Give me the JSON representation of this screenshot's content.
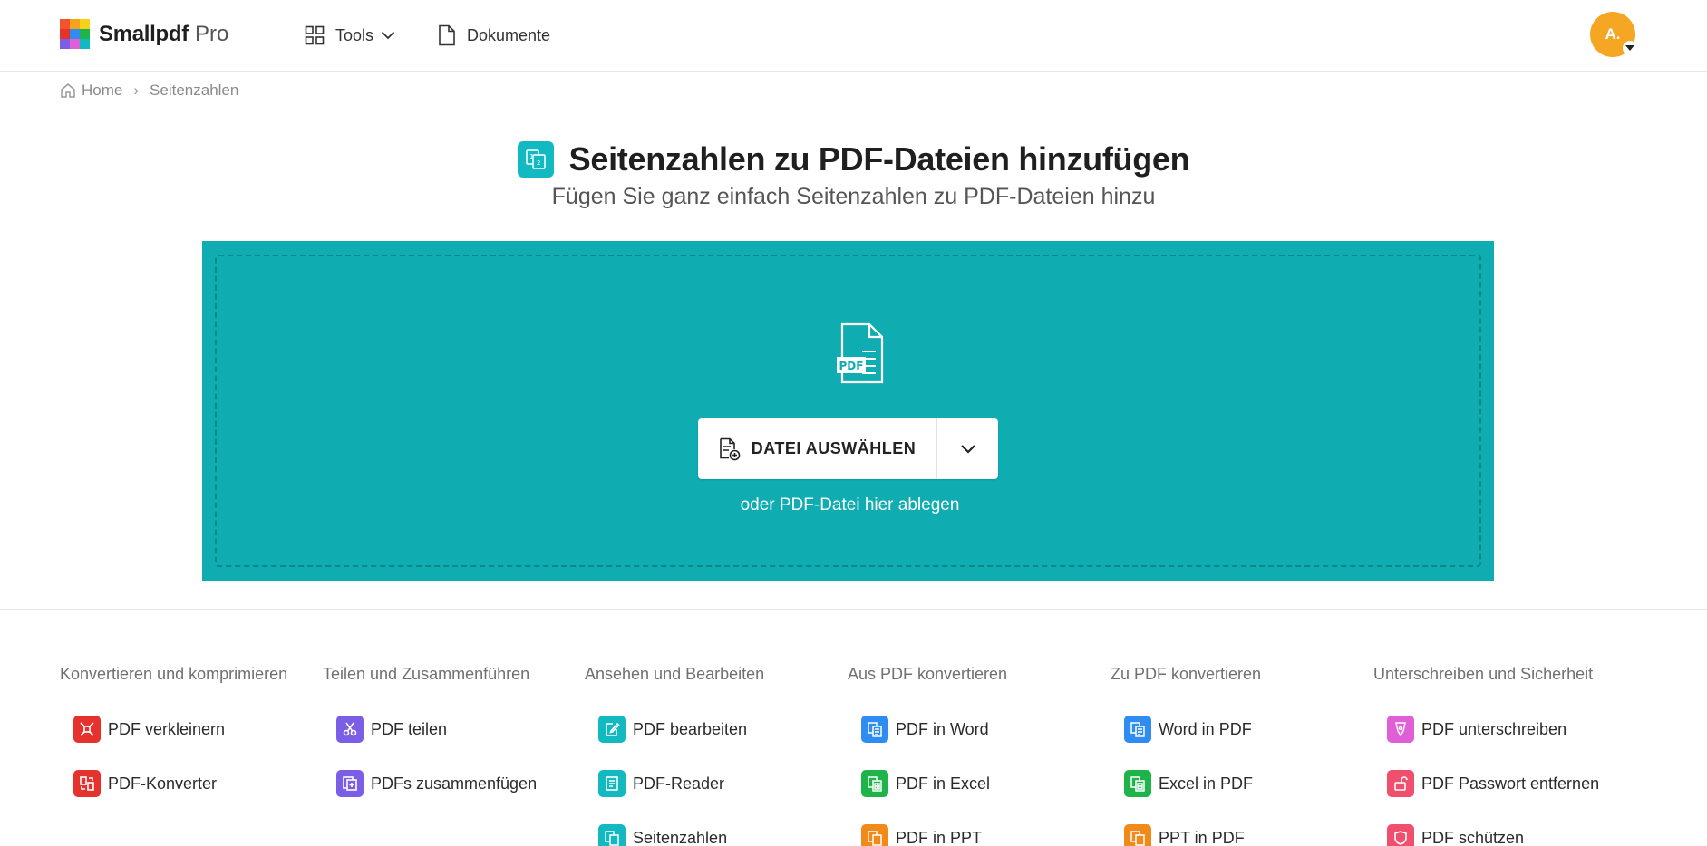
{
  "header": {
    "logo_name": "Smallpdf",
    "logo_suffix": "Pro",
    "nav": {
      "tools_label": "Tools",
      "documents_label": "Dokumente"
    },
    "avatar_initials": "A."
  },
  "breadcrumb": {
    "home": "Home",
    "separator": "›",
    "current": "Seitenzahlen"
  },
  "page": {
    "title": "Seitenzahlen zu PDF-Dateien hinzufügen",
    "subtitle": "Fügen Sie ganz einfach Seitenzahlen zu PDF-Dateien hinzu"
  },
  "upload": {
    "pdf_icon_label": "PDF",
    "choose_button": "DATEI AUSWÄHLEN",
    "drop_hint": "oder PDF-Datei hier ablegen",
    "background_color": "#0fadb1"
  },
  "categories": [
    {
      "title": "Konvertieren und komprimieren",
      "tools": [
        {
          "label": "PDF verkleinern",
          "icon": "compress-icon",
          "color": "#e5322d"
        },
        {
          "label": "PDF-Konverter",
          "icon": "convert-icon",
          "color": "#e5322d"
        }
      ]
    },
    {
      "title": "Teilen und Zusammenführen",
      "tools": [
        {
          "label": "PDF teilen",
          "icon": "scissors-icon",
          "color": "#7c5de6"
        },
        {
          "label": "PDFs zusammenfügen",
          "icon": "merge-icon",
          "color": "#7c5de6"
        }
      ]
    },
    {
      "title": "Ansehen und Bearbeiten",
      "tools": [
        {
          "label": "PDF bearbeiten",
          "icon": "edit-icon",
          "color": "#13b9c1"
        },
        {
          "label": "PDF-Reader",
          "icon": "reader-icon",
          "color": "#13b9c1"
        },
        {
          "label": "Seitenzahlen",
          "icon": "page-numbers-icon",
          "color": "#13b9c1"
        }
      ]
    },
    {
      "title": "Aus PDF konvertieren",
      "tools": [
        {
          "label": "PDF in Word",
          "icon": "word-icon",
          "color": "#2f8cf0"
        },
        {
          "label": "PDF in Excel",
          "icon": "excel-icon",
          "color": "#1fb44a"
        },
        {
          "label": "PDF in PPT",
          "icon": "ppt-icon",
          "color": "#f28a19"
        }
      ]
    },
    {
      "title": "Zu PDF konvertieren",
      "tools": [
        {
          "label": "Word in PDF",
          "icon": "word-icon",
          "color": "#2f8cf0"
        },
        {
          "label": "Excel in PDF",
          "icon": "excel-icon",
          "color": "#1fb44a"
        },
        {
          "label": "PPT in PDF",
          "icon": "ppt-icon",
          "color": "#f28a19"
        }
      ]
    },
    {
      "title": "Unterschreiben und Sicherheit",
      "tools": [
        {
          "label": "PDF unterschreiben",
          "icon": "sign-icon",
          "color": "#e05fd6"
        },
        {
          "label": "PDF Passwort entfernen",
          "icon": "unlock-icon",
          "color": "#f0506e"
        },
        {
          "label": "PDF schützen",
          "icon": "shield-icon",
          "color": "#f0506e"
        }
      ]
    }
  ]
}
